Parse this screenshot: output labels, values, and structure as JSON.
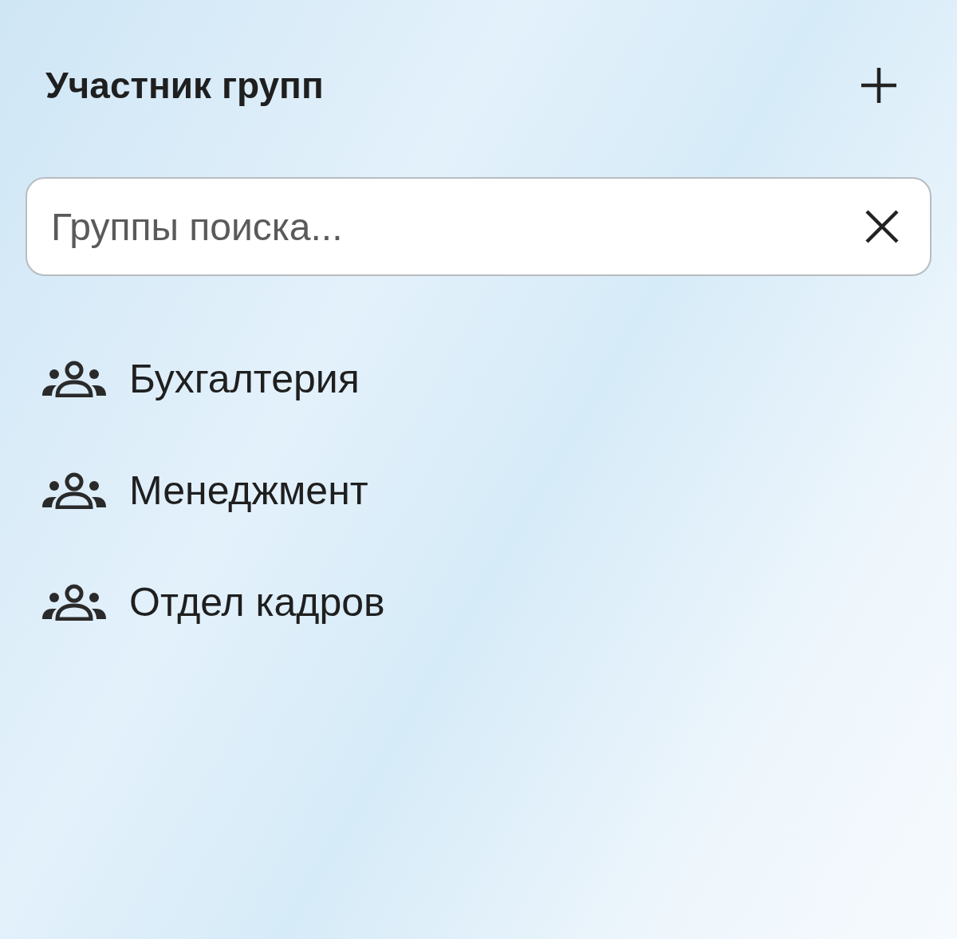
{
  "header": {
    "title": "Участник групп"
  },
  "search": {
    "placeholder": "Группы поиска..."
  },
  "groups": [
    {
      "label": "Бухгалтерия"
    },
    {
      "label": "Менеджмент"
    },
    {
      "label": "Отдел кадров"
    }
  ]
}
